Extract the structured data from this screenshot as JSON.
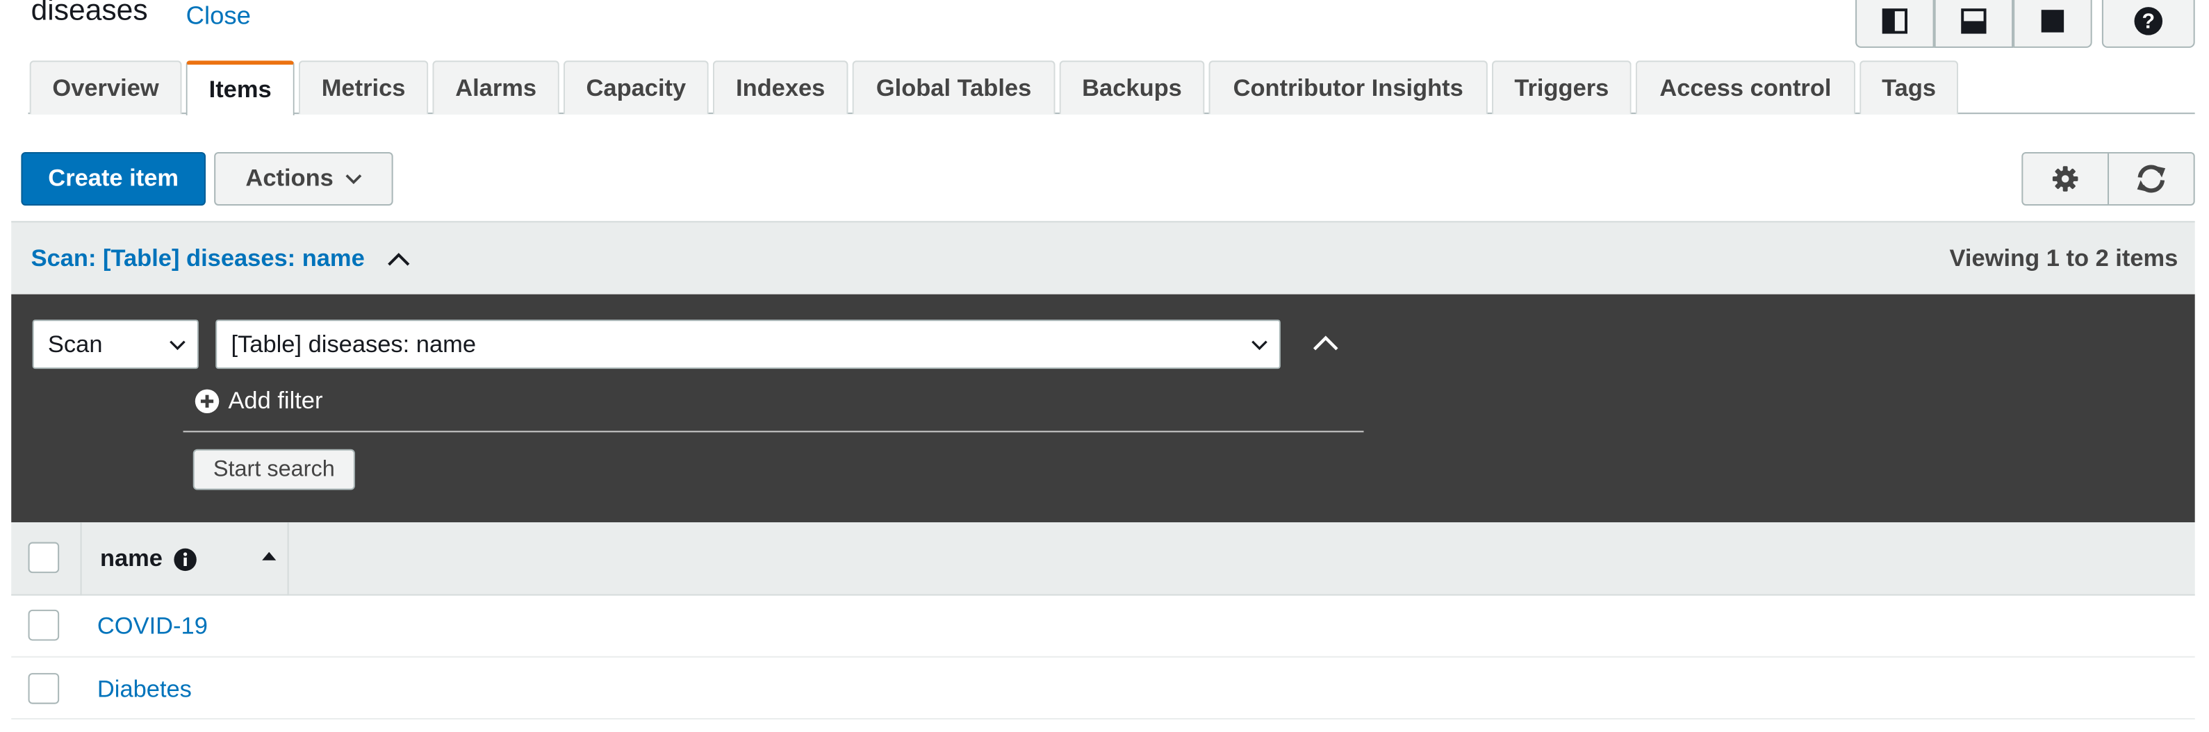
{
  "header": {
    "table_name": "diseases",
    "close_label": "Close"
  },
  "view_buttons": [
    {
      "name": "split-vertical-view-icon"
    },
    {
      "name": "split-horizontal-view-icon"
    },
    {
      "name": "full-view-icon"
    }
  ],
  "help_icon": "help-icon",
  "tabs": [
    {
      "label": "Overview",
      "active": false
    },
    {
      "label": "Items",
      "active": true
    },
    {
      "label": "Metrics",
      "active": false
    },
    {
      "label": "Alarms",
      "active": false
    },
    {
      "label": "Capacity",
      "active": false
    },
    {
      "label": "Indexes",
      "active": false
    },
    {
      "label": "Global Tables",
      "active": false
    },
    {
      "label": "Backups",
      "active": false
    },
    {
      "label": "Contributor Insights",
      "active": false
    },
    {
      "label": "Triggers",
      "active": false
    },
    {
      "label": "Access control",
      "active": false
    },
    {
      "label": "Tags",
      "active": false
    }
  ],
  "toolbar": {
    "create_label": "Create item",
    "actions_label": "Actions",
    "settings_icon": "gear-icon",
    "refresh_icon": "refresh-icon"
  },
  "scan": {
    "title": "Scan: [Table] diseases: name",
    "viewing": "Viewing 1 to 2 items",
    "mode_value": "Scan",
    "target_value": "[Table] diseases: name",
    "add_filter_label": "Add filter",
    "start_search_label": "Start search"
  },
  "table": {
    "columns": [
      {
        "label": "name",
        "sort": "ascending"
      }
    ],
    "rows": [
      {
        "name": "COVID-19"
      },
      {
        "name": "Diabetes"
      }
    ]
  },
  "colors": {
    "accent": "#0073bb",
    "active_tab": "#ec7211",
    "panel_dark": "#3e3e3e"
  }
}
